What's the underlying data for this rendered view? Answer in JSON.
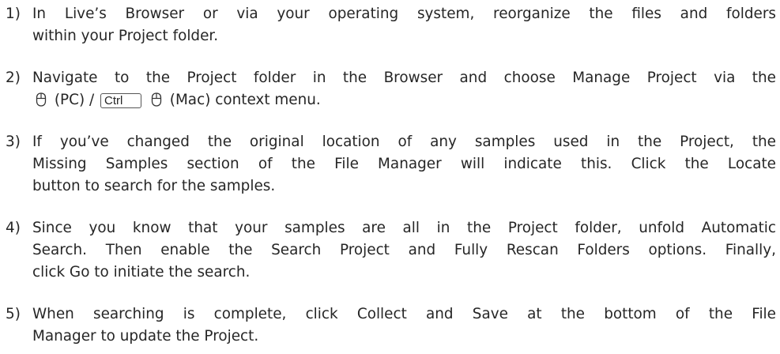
{
  "steps": [
    {
      "number": "1)",
      "lines": [
        "In Live’s Browser or via your operating system, reorganize the files and folders",
        "within your Project folder."
      ]
    },
    {
      "number": "2)",
      "line1": "Navigate to the Project folder in the Browser and choose Manage Project via the",
      "pc_text": "(PC) /",
      "key_label": "Ctrl",
      "mac_text": "(Mac) context menu."
    },
    {
      "number": "3)",
      "lines": [
        "If you’ve changed the original location of any samples used in the Project, the",
        "Missing Samples section of the File Manager will indicate this. Click the Locate",
        "button to search for the samples."
      ]
    },
    {
      "number": "4)",
      "lines": [
        "Since you know that your samples are all in the Project folder, unfold Automatic",
        "Search. Then enable the Search Project and Fully Rescan Folders options. Finally,",
        "click Go to initiate the search."
      ]
    },
    {
      "number": "5)",
      "lines": [
        "When searching is complete, click Collect and Save at the bottom of the File",
        "Manager to update the Project."
      ]
    }
  ],
  "icons": {
    "right_mouse": "right-mouse-button-icon",
    "left_mouse": "left-mouse-button-icon"
  }
}
